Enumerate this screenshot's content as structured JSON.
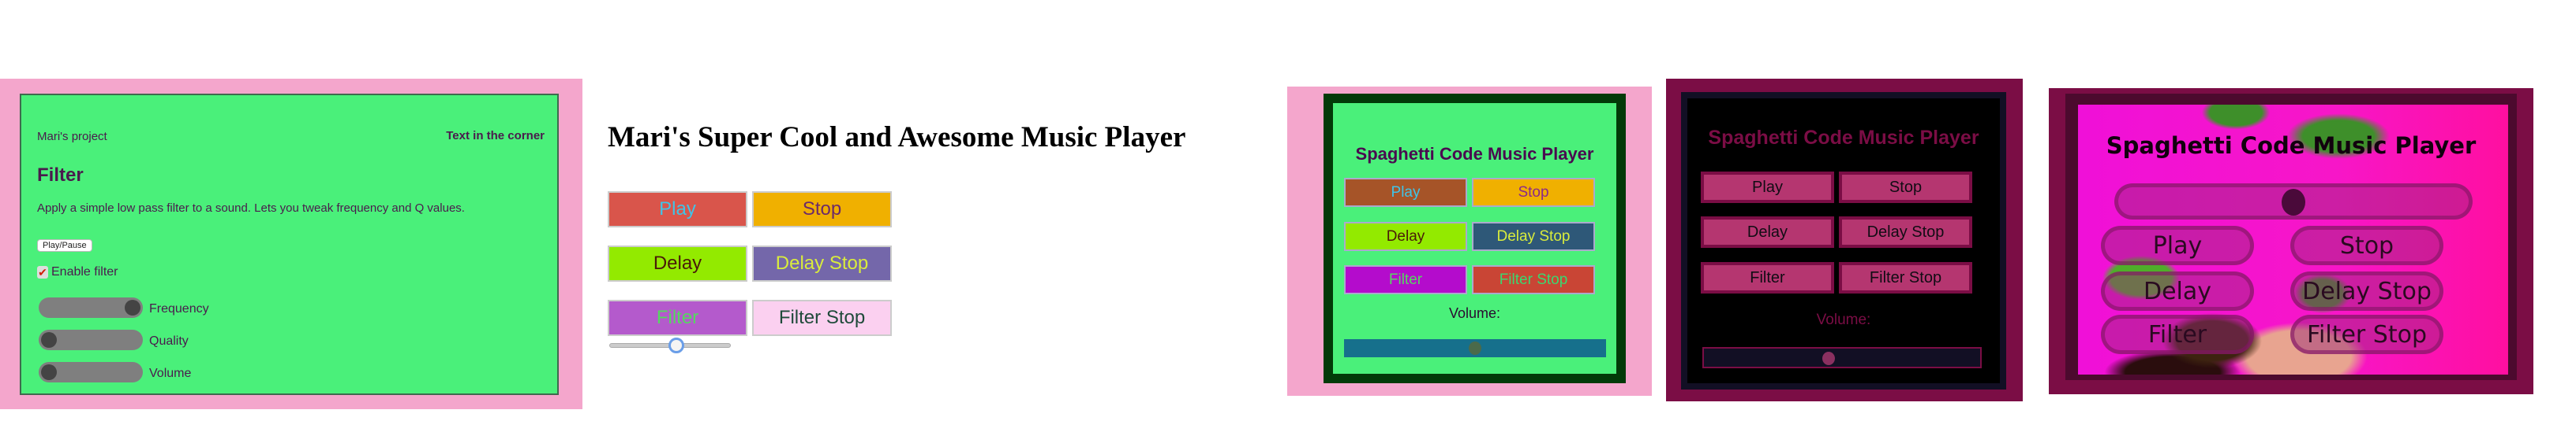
{
  "panel1": {
    "project": "Mari's project",
    "corner": "Text in the corner",
    "heading": "Filter",
    "description": "Apply a simple low pass filter to a sound. Lets you tweak frequency and Q values.",
    "play_pause": "Play/Pause",
    "enable_filter": "Enable filter",
    "enable_filter_checked": true,
    "sliders": [
      {
        "label": "Frequency",
        "value": 1.0
      },
      {
        "label": "Quality",
        "value": 0.0
      },
      {
        "label": "Volume",
        "value": 0.0
      }
    ],
    "colors": {
      "background": "#f4a6cc",
      "card": "#4af07a",
      "text": "#4a1b4d"
    }
  },
  "panel2": {
    "title": "Mari's Super Cool and Awesome Music Player",
    "buttons": [
      {
        "label": "Play",
        "bg": "#d9554b",
        "fg": "#3fc4e8"
      },
      {
        "label": "Stop",
        "bg": "#f0b000",
        "fg": "#6b2a6a"
      },
      {
        "label": "Delay",
        "bg": "#93ea00",
        "fg": "#4a1a08"
      },
      {
        "label": "Delay Stop",
        "bg": "#7467aa",
        "fg": "#d9ec3c"
      },
      {
        "label": "Filter",
        "bg": "#b45acc",
        "fg": "#55d860"
      },
      {
        "label": "Filter Stop",
        "bg": "#fbd0f0",
        "fg": "#1f4a3a"
      }
    ],
    "volume_value": 0.6
  },
  "panel3": {
    "title": "Spaghetti Code Music Player",
    "buttons": [
      {
        "label": "Play",
        "bg": "#a65428",
        "fg": "#3fc4e8"
      },
      {
        "label": "Stop",
        "bg": "#f0b000",
        "fg": "#8a2a8a"
      },
      {
        "label": "Delay",
        "bg": "#93ea00",
        "fg": "#4a1a08"
      },
      {
        "label": "Delay Stop",
        "bg": "#2e5878",
        "fg": "#d9ec3c"
      },
      {
        "label": "Filter",
        "bg": "#b40ccc",
        "fg": "#55d860"
      },
      {
        "label": "Filter Stop",
        "bg": "#c94535",
        "fg": "#3ad870"
      }
    ],
    "volume_label": "Volume:",
    "volume_value": 0.5
  },
  "panel4": {
    "title": "Spaghetti Code Music Player",
    "buttons": [
      "Play",
      "Stop",
      "Delay",
      "Delay Stop",
      "Filter",
      "Filter Stop"
    ],
    "volume_label": "Volume:",
    "volume_value": 0.45,
    "colors": {
      "accent": "#7b0d45",
      "button": "#b53670"
    }
  },
  "panel5": {
    "title": "Spaghetti Code Music Player",
    "buttons": [
      "Play",
      "Stop",
      "Delay",
      "Delay Stop",
      "Filter",
      "Filter Stop"
    ],
    "volume_value": 0.5
  }
}
